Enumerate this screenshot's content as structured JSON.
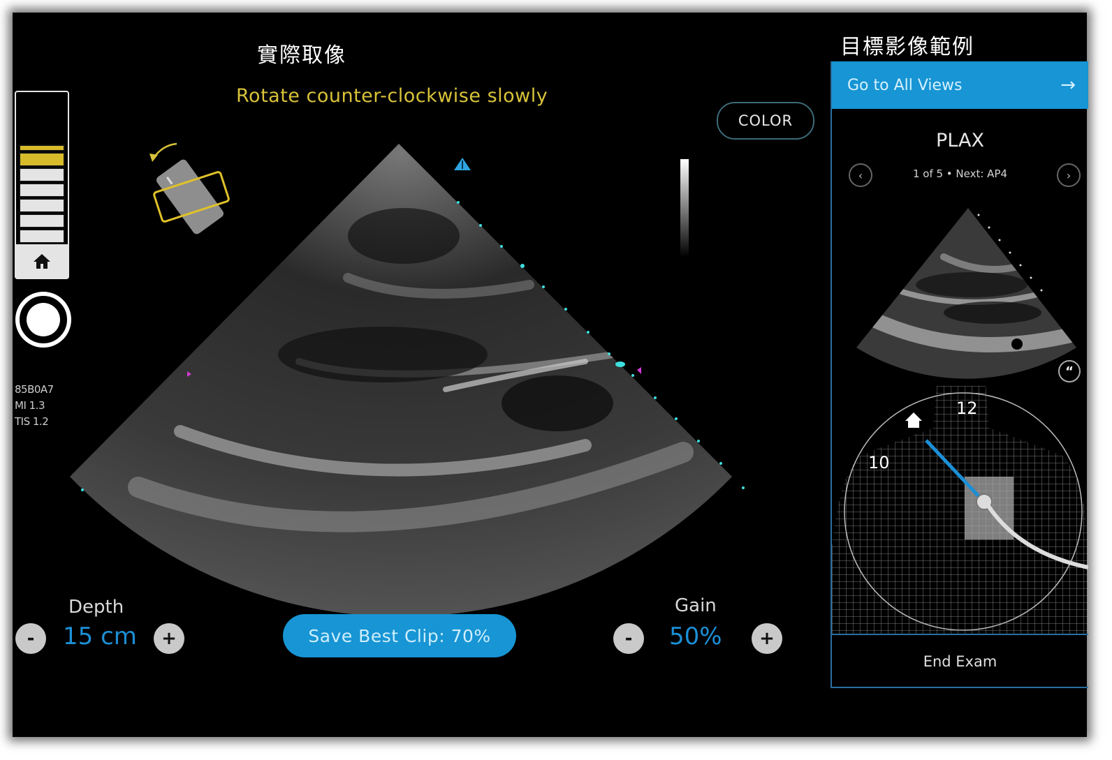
{
  "labels": {
    "actual_image": "實際取像",
    "target_example": "目標影像範例"
  },
  "guidance": {
    "instruction": "Rotate counter-clockwise slowly",
    "accent_color": "#d9c33a"
  },
  "depth_scale": {
    "total_segments": 7,
    "highlighted_segments": 2,
    "home_icon": "home-icon"
  },
  "capture_button": {
    "icon": "record-icon"
  },
  "probe_info": {
    "id": "85B0A7",
    "mi": "MI 1.3",
    "tis": "TIS 1.2"
  },
  "color_button": {
    "label": "COLOR"
  },
  "controls": {
    "depth": {
      "label": "Depth",
      "value": "15 cm",
      "minus": "-",
      "plus": "+"
    },
    "gain": {
      "label": "Gain",
      "value": "50%",
      "minus": "-",
      "plus": "+"
    },
    "save_clip": {
      "label": "Save Best Clip: 70%",
      "quality_percent": 70
    }
  },
  "right_panel": {
    "go_to_all_views": "Go to All Views",
    "arrow_icon": "→",
    "view_name": "PLAX",
    "view_progress": "1 of 5 • Next: AP4",
    "prev_icon": "‹",
    "next_icon": "›",
    "quote_icon": "“",
    "clock_labels": {
      "twelve": "12",
      "ten": "10"
    },
    "end_exam": "End Exam"
  },
  "colors": {
    "brand_blue": "#1795d4",
    "value_blue": "#1c8fd6",
    "marker_cyan": "#3ee0e0",
    "marker_magenta": "#d23bd6"
  }
}
